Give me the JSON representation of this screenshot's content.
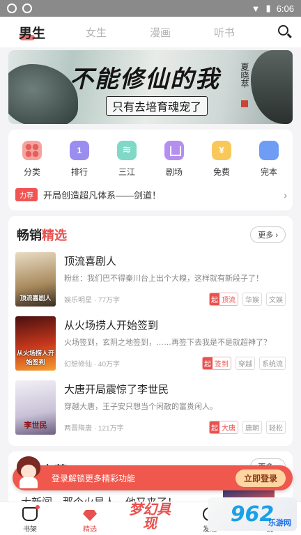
{
  "status_bar": {
    "time": "6:06"
  },
  "top_tabs": [
    {
      "label": "男生",
      "active": true
    },
    {
      "label": "女生",
      "active": false
    },
    {
      "label": "漫画",
      "active": false
    },
    {
      "label": "听书",
      "active": false
    }
  ],
  "banner": {
    "title": "不能修仙的我",
    "subtitle": "只有去培育魂宠了",
    "author": "夏晓萃"
  },
  "categories": [
    {
      "label": "分类",
      "icon": "grid-icon"
    },
    {
      "label": "排行",
      "icon": "ranking-icon",
      "icon_text": "1"
    },
    {
      "label": "三江",
      "icon": "waves-icon"
    },
    {
      "label": "剧场",
      "icon": "theater-icon"
    },
    {
      "label": "免费",
      "icon": "coin-icon",
      "icon_text": "¥"
    },
    {
      "label": "完本",
      "icon": "book-icon"
    }
  ],
  "notice": {
    "tag": "力荐",
    "text": "开局创造超凡体系——剑道！"
  },
  "bestsellers": {
    "title_a": "畅销",
    "title_b": "精选",
    "more": "更多",
    "books": [
      {
        "title": "顶流喜剧人",
        "cover_title": "顶流喜剧人",
        "desc": "粉丝：我们巴不得秦川台上出个大糗，这样就有新段子了！",
        "meta": "娱乐明星 · 77万字",
        "primary_tag": "顶流",
        "tags": [
          "华娱",
          "文娱"
        ]
      },
      {
        "title": "从火场捞人开始签到",
        "cover_title": "从火场捞人开始签到",
        "desc": "火场签到，玄阴之地签到，……再签下去我是不是就超神了？",
        "meta": "幻想修仙 · 40万字",
        "primary_tag": "签到",
        "tags": [
          "穿越",
          "系统流"
        ]
      },
      {
        "title": "大唐开局震惊了李世民",
        "cover_title": "李世民",
        "desc": "穿越大唐，王子安只想当个闲散的富贵闲人。",
        "meta": "两晋隋唐 · 121万字",
        "primary_tag": "大唐",
        "tags": [
          "唐朝",
          "轻松"
        ]
      }
    ]
  },
  "editor_rec": {
    "title": "主编力荐",
    "more": "更多",
    "teaser": "大新闻，那个火星人，他又来了！"
  },
  "login_prompt": {
    "text": "登录解锁更多精彩功能",
    "button": "立即登录"
  },
  "bottom_nav": [
    {
      "label": "书架",
      "active": false
    },
    {
      "label": "精选",
      "active": true
    },
    {
      "label": "梦幻具现",
      "active": false
    },
    {
      "label": "发现",
      "active": false
    },
    {
      "label": "我",
      "active": false
    }
  ],
  "watermark": {
    "big": "962",
    "small": "乐游网"
  },
  "colors": {
    "accent": "#e8514f",
    "login_bar": "#f0574d"
  }
}
